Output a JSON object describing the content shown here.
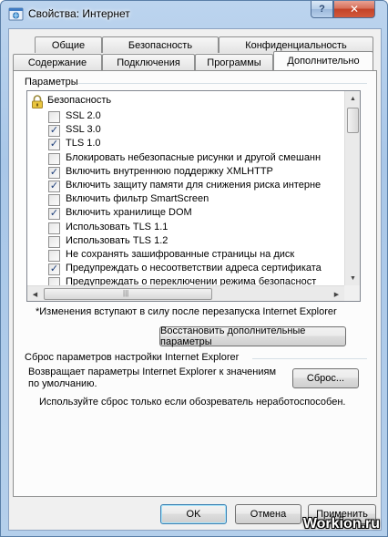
{
  "window": {
    "title": "Свойства: Интернет",
    "help_label": "?",
    "close_label": "✕"
  },
  "tabs_back": [
    {
      "label": "Общие"
    },
    {
      "label": "Безопасность"
    },
    {
      "label": "Конфиденциальность"
    }
  ],
  "tabs_front": [
    {
      "label": "Содержание"
    },
    {
      "label": "Подключения"
    },
    {
      "label": "Программы"
    },
    {
      "label": "Дополнительно",
      "active": true
    }
  ],
  "settings": {
    "group_label": "Параметры",
    "category": "Безопасность",
    "items": [
      {
        "label": "SSL 2.0",
        "checked": false
      },
      {
        "label": "SSL 3.0",
        "checked": true
      },
      {
        "label": "TLS 1.0",
        "checked": true
      },
      {
        "label": "Блокировать небезопасные рисунки и другой смешанн",
        "checked": false
      },
      {
        "label": "Включить внутреннюю поддержку XMLHTTP",
        "checked": true
      },
      {
        "label": "Включить защиту памяти для снижения риска интерне",
        "checked": true
      },
      {
        "label": "Включить фильтр SmartScreen",
        "checked": false
      },
      {
        "label": "Включить хранилище DOM",
        "checked": true
      },
      {
        "label": "Использовать TLS 1.1",
        "checked": false
      },
      {
        "label": "Использовать TLS 1.2",
        "checked": false
      },
      {
        "label": "Не сохранять зашифрованные страницы на диск",
        "checked": false
      },
      {
        "label": "Предупреждать о несоответствии адреса сертификата",
        "checked": true
      },
      {
        "label": "Предупреждать о переключении режима безопасност",
        "checked": false
      }
    ],
    "note": "*Изменения вступают в силу после перезапуска Internet Explorer",
    "restore_button": "Восстановить дополнительные параметры"
  },
  "reset": {
    "group_label": "Сброс параметров настройки Internet Explorer",
    "description_line1": "Возвращает параметры Internet Explorer к значениям",
    "description_line2": "по умолчанию.",
    "reset_button": "Сброс...",
    "warning": "Используйте сброс только если обозреватель неработоспособен."
  },
  "footer": {
    "ok": "OK",
    "cancel": "Отмена",
    "apply": "Применить"
  },
  "watermark": "Workion.ru"
}
